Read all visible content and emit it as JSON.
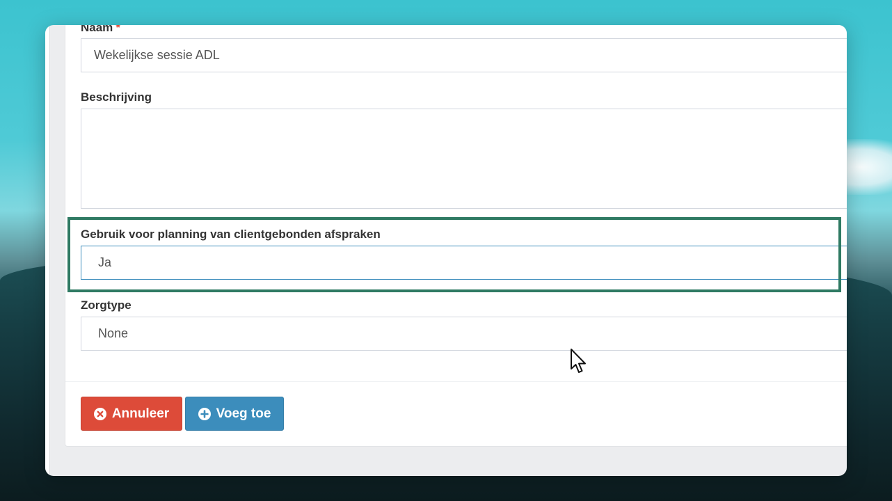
{
  "form": {
    "naam": {
      "label": "Naam",
      "required_mark": "*",
      "value": "Wekelijkse sessie ADL"
    },
    "beschrijving": {
      "label": "Beschrijving",
      "value": ""
    },
    "planning": {
      "label": "Gebruik voor planning van clientgebonden afspraken",
      "value": "Ja"
    },
    "zorgtype": {
      "label": "Zorgtype",
      "value": "None"
    }
  },
  "buttons": {
    "cancel_label": "Annuleer",
    "add_label": "Voeg toe"
  },
  "colors": {
    "cancel": "#dd4b39",
    "add": "#3c8dbc",
    "highlight": "#2f7a63"
  },
  "icons": {
    "cancel": "times-circle-icon",
    "add": "plus-circle-icon",
    "cursor": "mouse-pointer-icon"
  }
}
